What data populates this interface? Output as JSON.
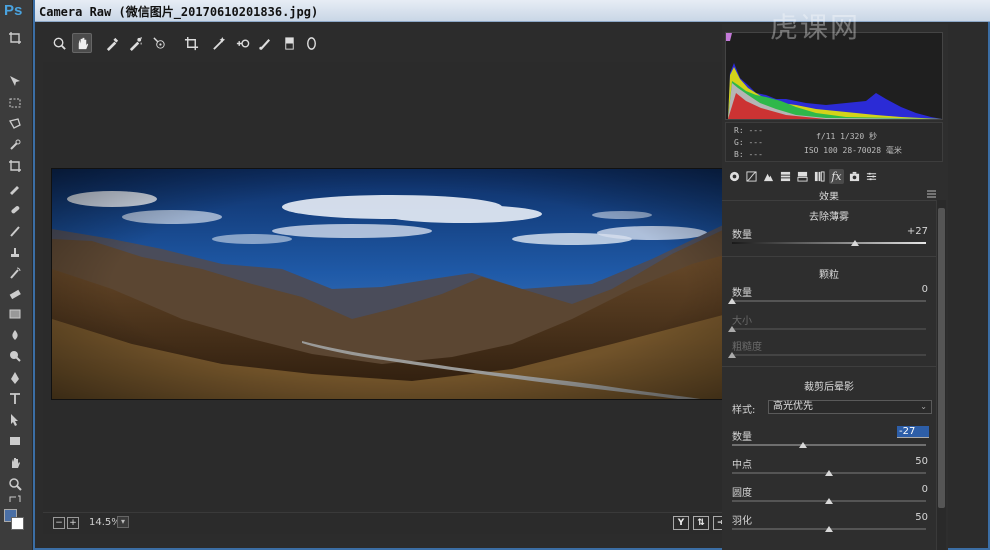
{
  "app": {
    "ps_logo": "Ps"
  },
  "window": {
    "title": "Camera Raw (微信图片_20170610201836.jpg)"
  },
  "toolbar": {
    "tools": [
      "zoom-icon",
      "hand-icon",
      "white-balance-icon",
      "color-sampler-icon",
      "target-adjust-icon",
      "crop-icon",
      "straighten-icon",
      "spot-removal-icon",
      "red-eye-icon",
      "adjustment-brush-icon",
      "graduated-filter-icon",
      "radial-filter-icon"
    ],
    "active_tool": "hand-icon"
  },
  "bottom": {
    "zoom": "14.5%",
    "view_y_label": "Y"
  },
  "readout": {
    "r": "R:  ---",
    "g": "G:  ---",
    "b": "B:  ---",
    "camera_line1": "f/11   1/320 秒",
    "camera_line2": "ISO 100   28-70028 毫米"
  },
  "panel": {
    "tab_active": "fx-effects-tab",
    "header": "效果",
    "dehaze": {
      "title": "去除薄雾",
      "amount_label": "数量",
      "amount_value": "+27",
      "amount_level": 0.635
    },
    "grain": {
      "title": "颗粒",
      "amount_label": "数量",
      "amount_value": "0",
      "size_label": "大小",
      "roughness_label": "粗糙度"
    },
    "vignette": {
      "title": "裁剪后晕影",
      "style_label": "样式:",
      "style_value": "高光优先",
      "amount_label": "数量",
      "amount_value": "-27",
      "amount_level": 0.365,
      "midpoint_label": "中点",
      "midpoint_value": "50",
      "roundness_label": "圆度",
      "roundness_value": "0",
      "feather_label": "羽化",
      "feather_value": "50"
    }
  },
  "watermark": "虎课网",
  "colors": {
    "accent": "#2d5ea8",
    "window_border": "#3b6ea5"
  }
}
